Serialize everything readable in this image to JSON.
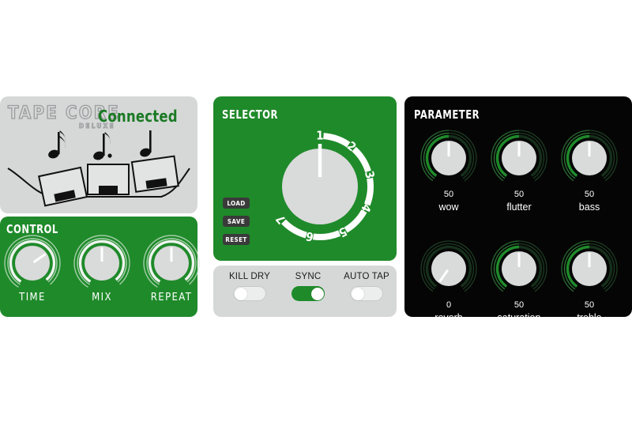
{
  "app": {
    "brand_line1": "TAPE CORE",
    "brand_line2": "DELUXE",
    "status": "Connected",
    "accent_green": "#1f8a2a",
    "panel_gray": "#d6d8d8",
    "panel_black": "#050505",
    "knob_gray": "#d9dada"
  },
  "header": {
    "artwork_name": "tape-delay-illustration"
  },
  "control": {
    "title": "CONTROL",
    "knobs": [
      {
        "label": "TIME",
        "angle": 55
      },
      {
        "label": "MIX",
        "angle": 0
      },
      {
        "label": "REPEAT",
        "angle": 0
      }
    ]
  },
  "selector": {
    "title": "SELECTOR",
    "positions": [
      "1",
      "2",
      "3",
      "4",
      "5",
      "6",
      "7"
    ],
    "selected": "1",
    "buttons": [
      {
        "label": "LOAD"
      },
      {
        "label": "SAVE"
      },
      {
        "label": "RESET"
      }
    ]
  },
  "toggles": [
    {
      "label": "KILL DRY",
      "on": false
    },
    {
      "label": "SYNC",
      "on": true
    },
    {
      "label": "AUTO TAP",
      "on": false
    }
  ],
  "parameter": {
    "title": "PARAMETER",
    "knobs": [
      {
        "name": "wow",
        "value": "50",
        "pct": 50
      },
      {
        "name": "flutter",
        "value": "50",
        "pct": 50
      },
      {
        "name": "bass",
        "value": "50",
        "pct": 50
      },
      {
        "name": "reverb",
        "value": "0",
        "pct": 0
      },
      {
        "name": "saturation",
        "value": "50",
        "pct": 50
      },
      {
        "name": "treble",
        "value": "50",
        "pct": 50
      }
    ]
  }
}
